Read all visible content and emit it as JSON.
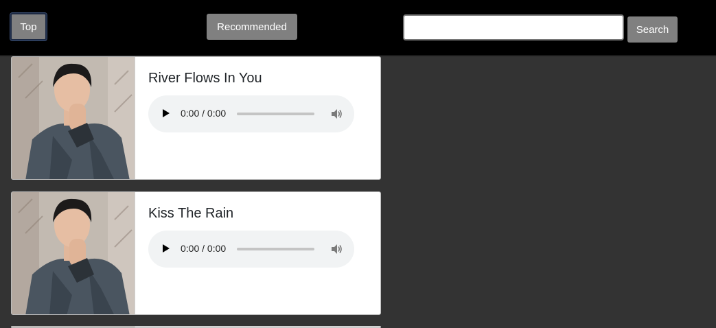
{
  "nav": {
    "top_label": "Top",
    "recommended_label": "Recommended",
    "search_value": "",
    "search_label": "Search"
  },
  "tracks": [
    {
      "title": "River Flows In You",
      "time": "0:00 / 0:00"
    },
    {
      "title": "Kiss The Rain",
      "time": "0:00 / 0:00"
    }
  ],
  "colors": {
    "topbar": "#000000",
    "background": "#333333",
    "button": "#808080",
    "card": "#ffffff",
    "player": "#f1f3f4"
  },
  "icons": {
    "play": "play-icon",
    "volume": "volume-icon",
    "artist_photo": "artist-photo"
  }
}
